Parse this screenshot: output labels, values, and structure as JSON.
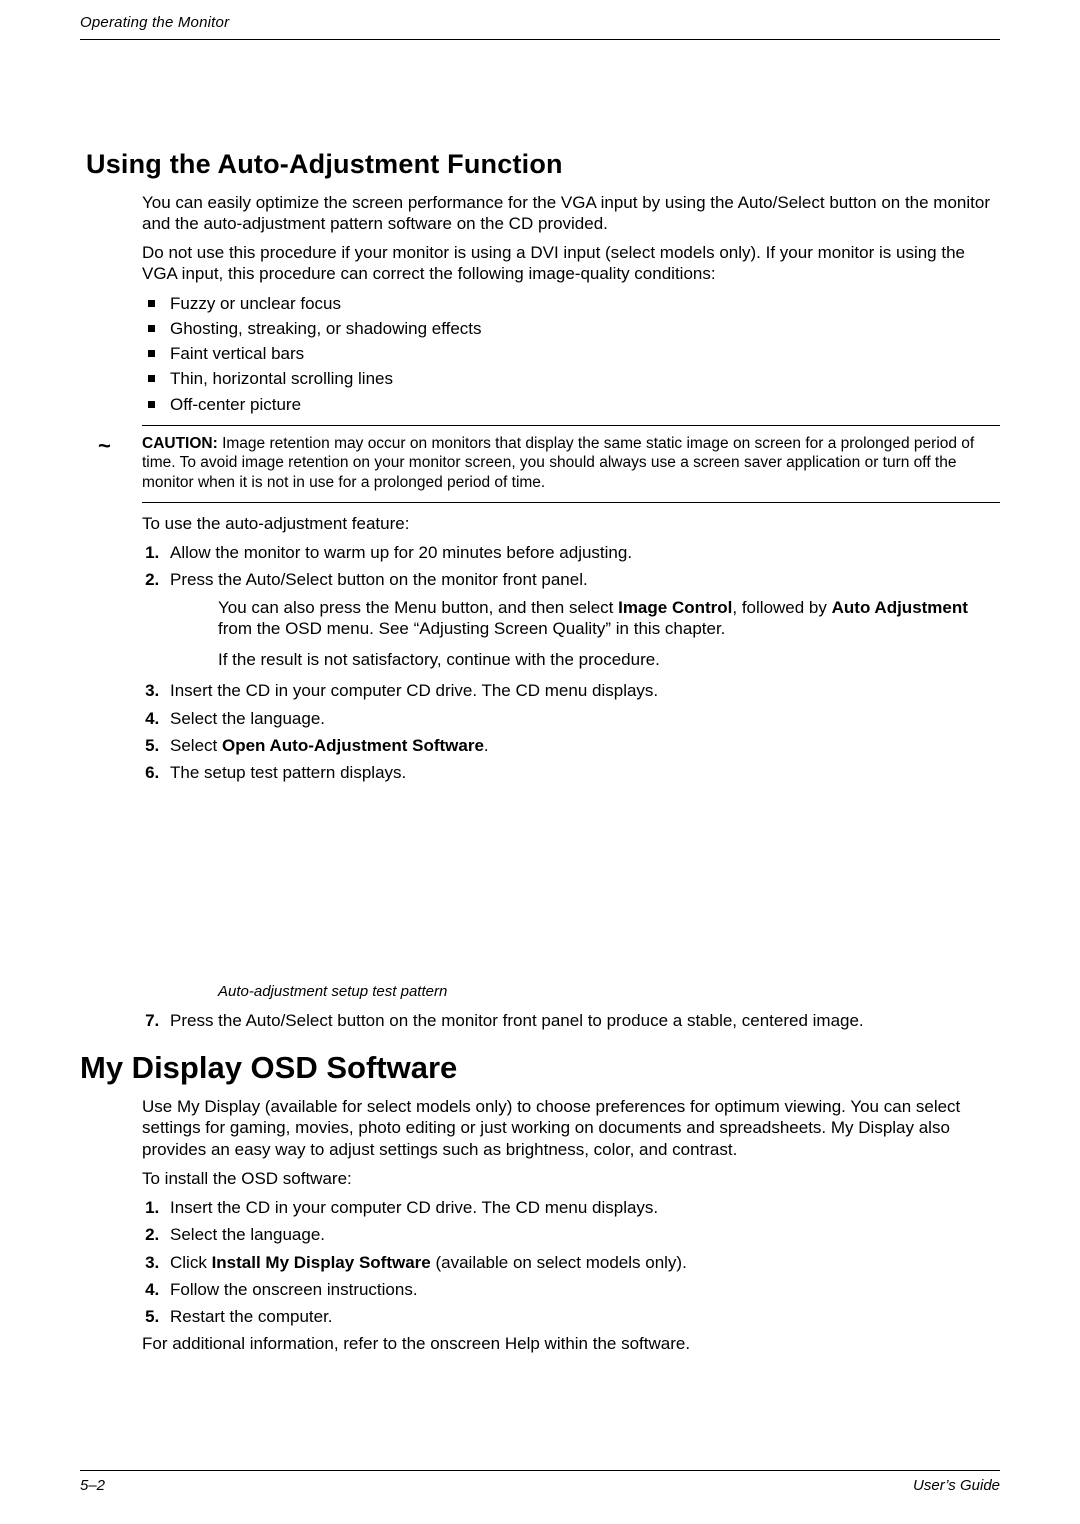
{
  "header": {
    "running": "Operating the Monitor"
  },
  "sec1": {
    "title": "Using the Auto-Adjustment Function",
    "p1": "You can easily optimize the screen performance for the VGA input by using the Auto/Select button on the monitor and the auto-adjustment pattern software on the CD provided.",
    "p2": "Do not use this procedure if your monitor is using a DVI input (select models only). If your monitor is using the VGA input, this procedure can correct the following image-quality conditions:",
    "bullets": [
      "Fuzzy or unclear focus",
      "Ghosting, streaking, or shadowing effects",
      "Faint vertical bars",
      "Thin, horizontal scrolling lines",
      "Off-center picture"
    ],
    "caution_label": "CAUTION:",
    "caution_text": " Image retention may occur on monitors that display the same static image on screen for a prolonged period of time. To avoid image retention on your monitor screen, you should always use a screen saver application or turn off the monitor when it is not in use for a prolonged period of time.",
    "p3": "To use the auto-adjustment feature:",
    "steps": {
      "s1": "Allow the monitor to warm up for 20 minutes before adjusting.",
      "s2": "Press the Auto/Select button on the monitor front panel.",
      "s2a_pre": "You can also press the Menu button, and then select ",
      "s2a_b1": "Image Control",
      "s2a_mid": ", followed by ",
      "s2a_b2": "Auto Adjustment",
      "s2a_post": " from the OSD menu. See “Adjusting Screen Quality” in this chapter.",
      "s2b": "If the result is not satisfactory, continue with the procedure.",
      "s3": "Insert the CD in your computer CD drive. The CD menu displays.",
      "s4": "Select the language.",
      "s5_pre": "Select ",
      "s5_b": "Open Auto-Adjustment Software",
      "s5_post": ".",
      "s6": "The setup test pattern displays.",
      "caption": "Auto-adjustment setup test pattern",
      "s7": "Press the Auto/Select button on the monitor front panel to produce a stable, centered image."
    }
  },
  "sec2": {
    "title": "My Display OSD Software",
    "p1": "Use My Display (available for select models only) to choose preferences for optimum viewing. You can select settings for gaming, movies, photo editing or just working on documents and spreadsheets. My Display also provides an easy way to adjust settings such as brightness, color, and contrast.",
    "p2": "To install the OSD software:",
    "steps": {
      "s1": "Insert the CD in your computer CD drive. The CD menu displays.",
      "s2": "Select the language.",
      "s3_pre": "Click ",
      "s3_b": "Install My Display Software",
      "s3_post": " (available on select models only).",
      "s4": "Follow the onscreen instructions.",
      "s5": "Restart the computer."
    },
    "p3": "For additional information, refer to the onscreen Help within the software."
  },
  "footer": {
    "left": "5–2",
    "right": "User’s Guide"
  },
  "glyphs": {
    "tilde": "~"
  }
}
